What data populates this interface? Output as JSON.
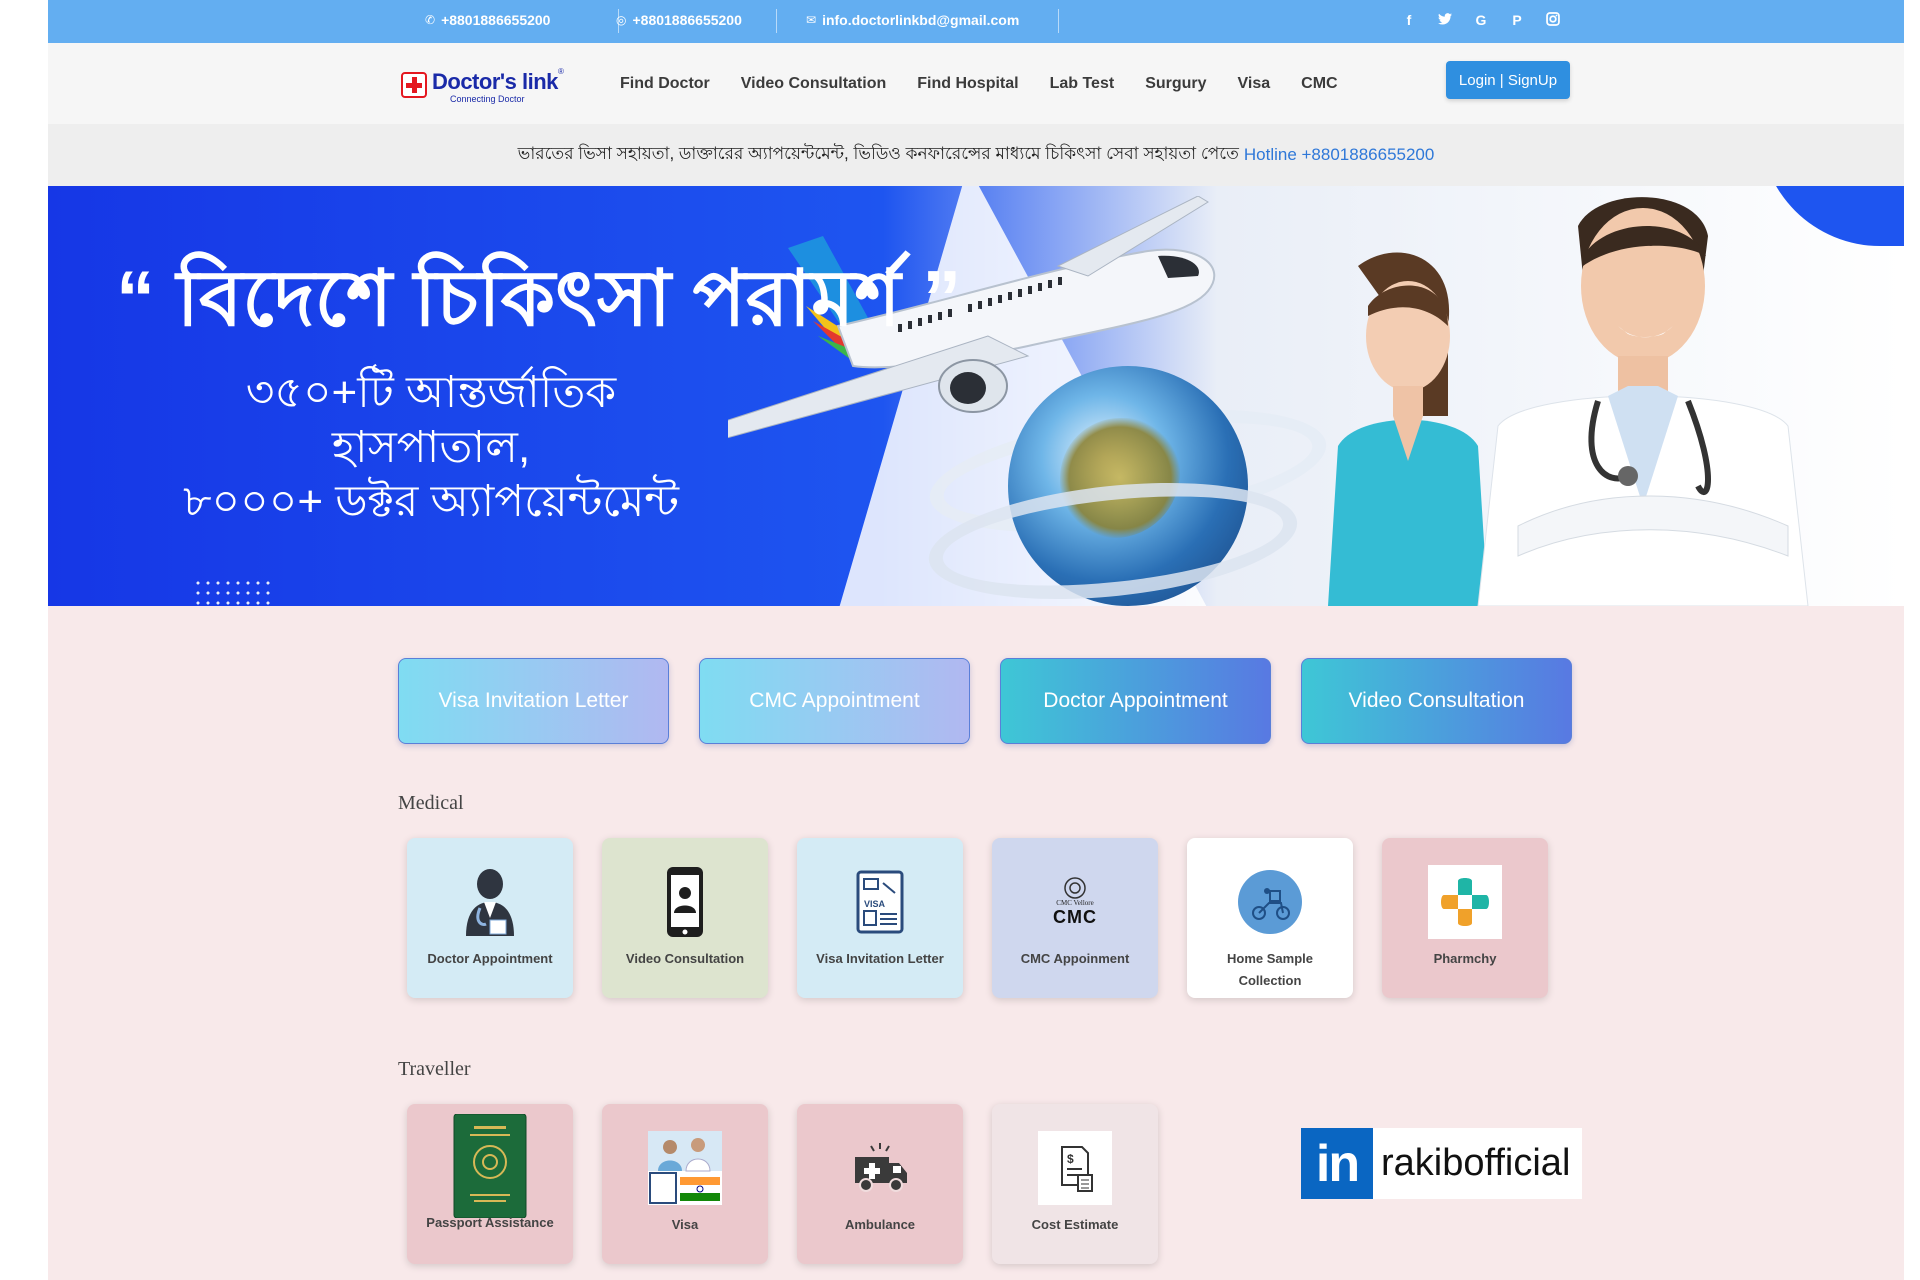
{
  "topbar": {
    "phone": "+8801886655200",
    "whatsapp": "+8801886655200",
    "email": "info.doctorlinkbd@gmail.com",
    "socials": [
      "facebook-icon",
      "twitter-icon",
      "google-icon",
      "pinterest-icon",
      "instagram-icon"
    ],
    "social_glyphs": [
      "f",
      "🐦",
      "G",
      "P",
      "◙"
    ]
  },
  "nav": {
    "logo_name": "Doctor's link",
    "logo_reg": "®",
    "logo_tagline": "Connecting Doctor",
    "links": [
      "Find Doctor",
      "Video Consultation",
      "Find Hospital",
      "Lab Test",
      "Surgury",
      "Visa",
      "CMC"
    ],
    "login": "Login | SignUp"
  },
  "notice": {
    "text": "ভারতের ভিসা সহায়তা, ডাক্তারের অ্যাপয়েন্টমেন্ট, ভিডিও কনফারেন্সের মাধ্যমে চিকিৎসা সেবা সহায়তা পেতে",
    "hotline": "Hotline +8801886655200"
  },
  "hero": {
    "title": "“ বিদেশে চিকিৎসা পরামর্শ ”",
    "line1": "৩৫০+টি আন্তর্জাতিক হাসপাতাল,",
    "line2": "৮০০০+ ডক্টর অ্যাপয়েন্টমেন্ট"
  },
  "quick_buttons": [
    "Visa Invitation Letter",
    "CMC Appointment",
    "Doctor Appointment",
    "Video Consultation"
  ],
  "medical": {
    "title": "Medical",
    "cards": [
      {
        "label": "Doctor Appointment",
        "icon": "doctor-icon"
      },
      {
        "label": "Video Consultation",
        "icon": "phone-doctor-icon"
      },
      {
        "label": "Visa Invitation Letter",
        "icon": "visa-document-icon"
      },
      {
        "label": "CMC Appoinment",
        "icon": "cmc-vellore-logo"
      },
      {
        "label": "Home Sample Collection",
        "icon": "delivery-scooter-icon"
      },
      {
        "label": "Pharmchy",
        "icon": "pharmacy-cross-icon"
      }
    ],
    "cmc_logo_text": "CMC",
    "cmc_logo_sub": "CMC Vellore"
  },
  "traveller": {
    "title": "Traveller",
    "cards": [
      {
        "label": "Passport Assistance",
        "icon": "passport-icon"
      },
      {
        "label": "Visa",
        "icon": "visa-india-icon"
      },
      {
        "label": "Ambulance",
        "icon": "ambulance-icon"
      },
      {
        "label": "Cost Estimate",
        "icon": "cost-estimate-icon"
      }
    ]
  },
  "watermark": {
    "brand": "in",
    "handle": "rakibofficial"
  }
}
